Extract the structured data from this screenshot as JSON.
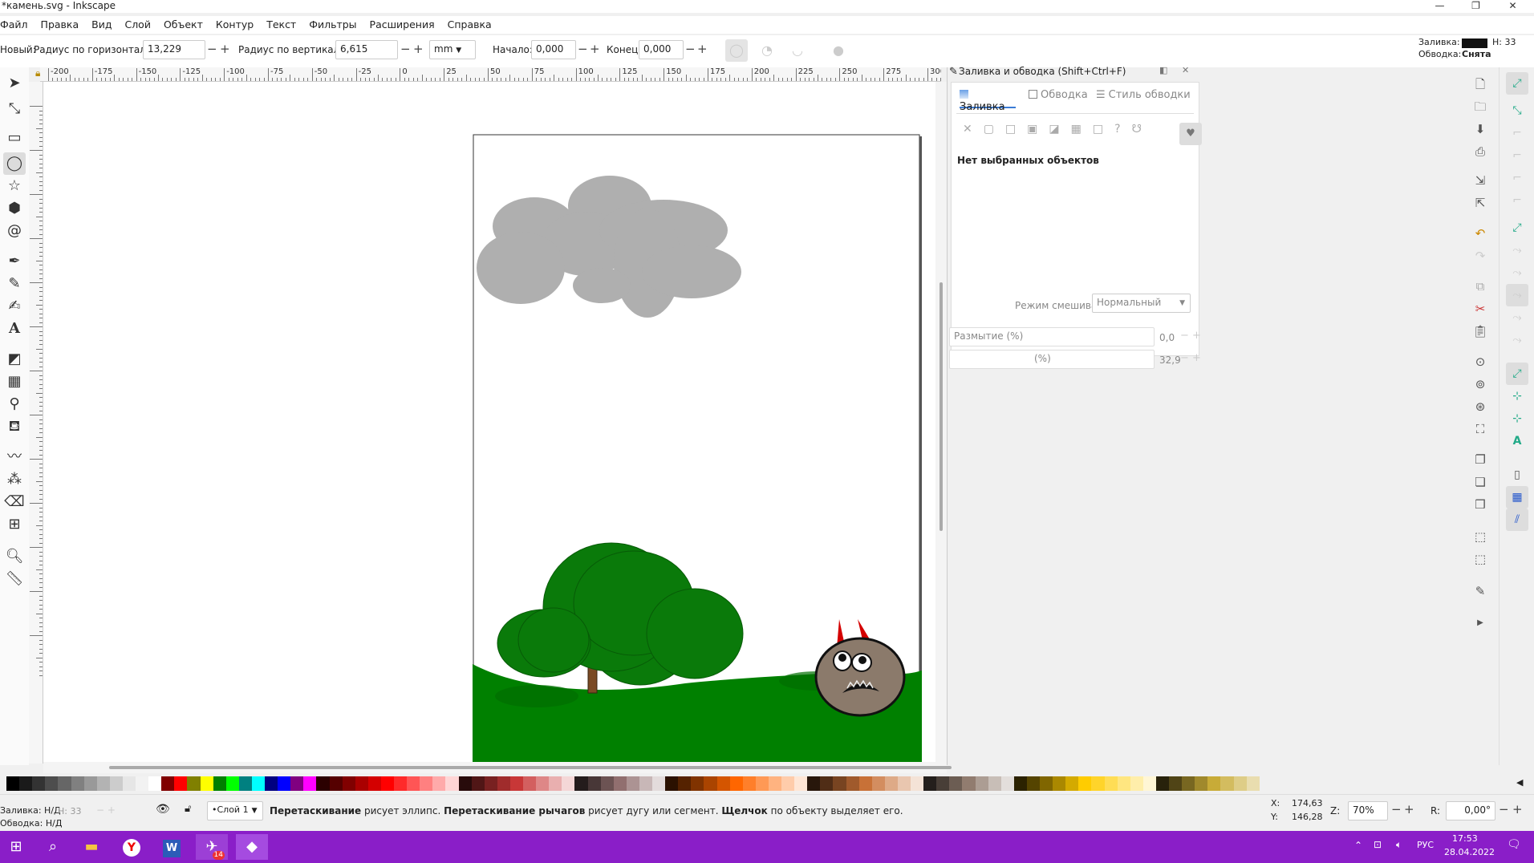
{
  "window": {
    "title": "*камень.svg - Inkscape",
    "minimize": "—",
    "maximize": "❐",
    "close": "✕"
  },
  "menu": [
    "Файл",
    "Правка",
    "Вид",
    "Слой",
    "Объект",
    "Контур",
    "Текст",
    "Фильтры",
    "Расширения",
    "Справка"
  ],
  "toolcontrols": {
    "new_label": "Новый:",
    "rx_label": "Радиус по горизонтали:",
    "rx_value": "13,229",
    "ry_label": "Радиус по вертикали:",
    "ry_value": "6,615",
    "unit": "mm",
    "start_label": "Начало:",
    "start_value": "0,000",
    "end_label": "Конец:",
    "end_value": "0,000",
    "minus": "−",
    "plus": "+"
  },
  "style_indicator": {
    "fill_label": "Заливка:",
    "stroke_label": "Обводка:",
    "stroke_value": "Снята",
    "h_label": "Н:",
    "h_value": "33"
  },
  "ruler": {
    "h_labels": [
      "-200",
      "-175",
      "-150",
      "-125",
      "-100",
      "-75",
      "-50",
      "-25",
      "0",
      "25",
      "50",
      "75",
      "100",
      "125",
      "150",
      "175",
      "200",
      "225",
      "250",
      "275",
      "300"
    ],
    "v_labels": [
      "0",
      "25",
      "50",
      "75",
      "100",
      "125",
      "150",
      "175",
      "200",
      "225",
      "250",
      "275",
      "300"
    ]
  },
  "dialog": {
    "title": "Заливка и обводка (Shift+Ctrl+F)",
    "tabs": [
      "Заливка",
      "Обводка",
      "Стиль обводки"
    ],
    "no_selection": "Нет выбранных объектов",
    "blend_label": "Режим смешивания:",
    "blend_value": "Нормальный",
    "blur_label": "Размытие (%)",
    "blur_value": "0,0",
    "opacity_label": "(%)",
    "opacity_value": "32,9"
  },
  "statusbar": {
    "fill_label": "Заливка:",
    "fill_value": "Н/Д",
    "stroke_label": "Обводка:",
    "stroke_value": "Н/Д",
    "h_label": "Н:",
    "h_value": "33",
    "layer": "•Слой 1",
    "msg_b1": "Перетаскивание",
    "msg_t1": " рисует эллипс. ",
    "msg_b2": "Перетаскивание рычагов",
    "msg_t2": " рисует дугу или сегмент. ",
    "msg_b3": "Щелчок",
    "msg_t3": " по объекту выделяет его.",
    "x_label": "X:",
    "x_value": "174,63",
    "y_label": "Y:",
    "y_value": "146,28",
    "z_label": "Z:",
    "zoom": "70%",
    "r_label": "R:",
    "rotation": "0,00°"
  },
  "taskbar": {
    "lang": "РУС",
    "time": "17:53",
    "date": "28.04.2022",
    "badge": "14"
  },
  "colors": {
    "taskbar": "#8a1ec8",
    "grass": "#008000",
    "tree_green": "#0a7a0a",
    "trunk": "#7a4a24",
    "stone": "#8b7a6b",
    "horns": "#d40000",
    "cloud": "#808080"
  },
  "icons": {
    "tools": [
      "selector-icon",
      "node-icon",
      "rect-icon",
      "ellipse-icon",
      "star-icon",
      "3dbox-icon",
      "spiral-icon",
      "pen-icon",
      "pencil-icon",
      "calligraphy-icon",
      "text-icon",
      "gradient-icon",
      "mesh-icon",
      "dropper-icon",
      "paint-bucket-icon",
      "tweak-icon",
      "spray-icon",
      "eraser-icon",
      "connector-icon",
      "zoom-icon",
      "measure-icon"
    ]
  }
}
